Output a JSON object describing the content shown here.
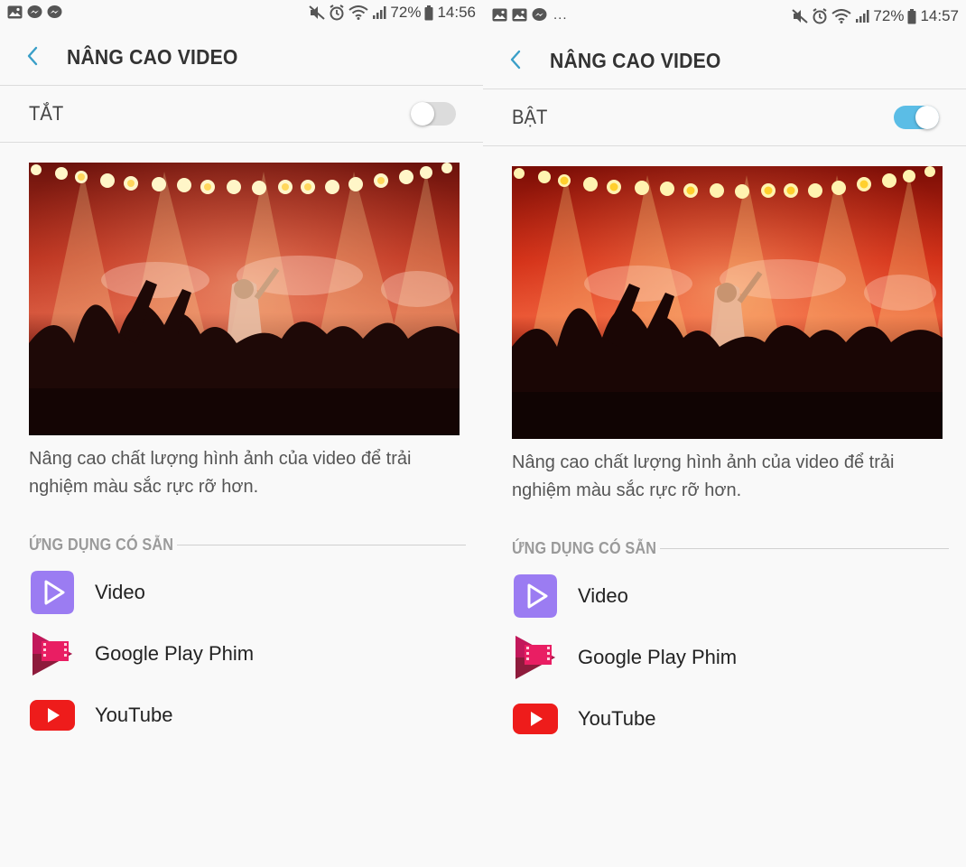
{
  "screens": [
    {
      "status": {
        "battery": "72%",
        "time": "14:56",
        "show_more": false
      },
      "title": "NÂNG CAO VIDEO",
      "toggle_label": "TẮT",
      "toggle_on": false,
      "description": "Nâng cao chất lượng hình ảnh của video để trải nghiệm màu sắc rực rỡ hơn.",
      "section_title": "ỨNG DỤNG CÓ SẴN",
      "apps": [
        {
          "name": "Video",
          "icon": "video-app-icon"
        },
        {
          "name": "Google Play Phim",
          "icon": "google-play-movies-icon"
        },
        {
          "name": "YouTube",
          "icon": "youtube-icon"
        }
      ]
    },
    {
      "status": {
        "battery": "72%",
        "time": "14:57",
        "show_more": true,
        "more": "..."
      },
      "title": "NÂNG CAO VIDEO",
      "toggle_label": "BẬT",
      "toggle_on": true,
      "description": "Nâng cao chất lượng hình ảnh của video để trải nghiệm màu sắc rực rỡ hơn.",
      "section_title": "ỨNG DỤNG CÓ SẴN",
      "apps": [
        {
          "name": "Video",
          "icon": "video-app-icon"
        },
        {
          "name": "Google Play Phim",
          "icon": "google-play-movies-icon"
        },
        {
          "name": "YouTube",
          "icon": "youtube-icon"
        }
      ]
    }
  ],
  "colors": {
    "accent": "#5bbde6",
    "back_arrow": "#3a9fc8",
    "video_icon": "#9b7cf2",
    "youtube_red": "#ee1c1b",
    "play_movies": "#c2185b"
  }
}
